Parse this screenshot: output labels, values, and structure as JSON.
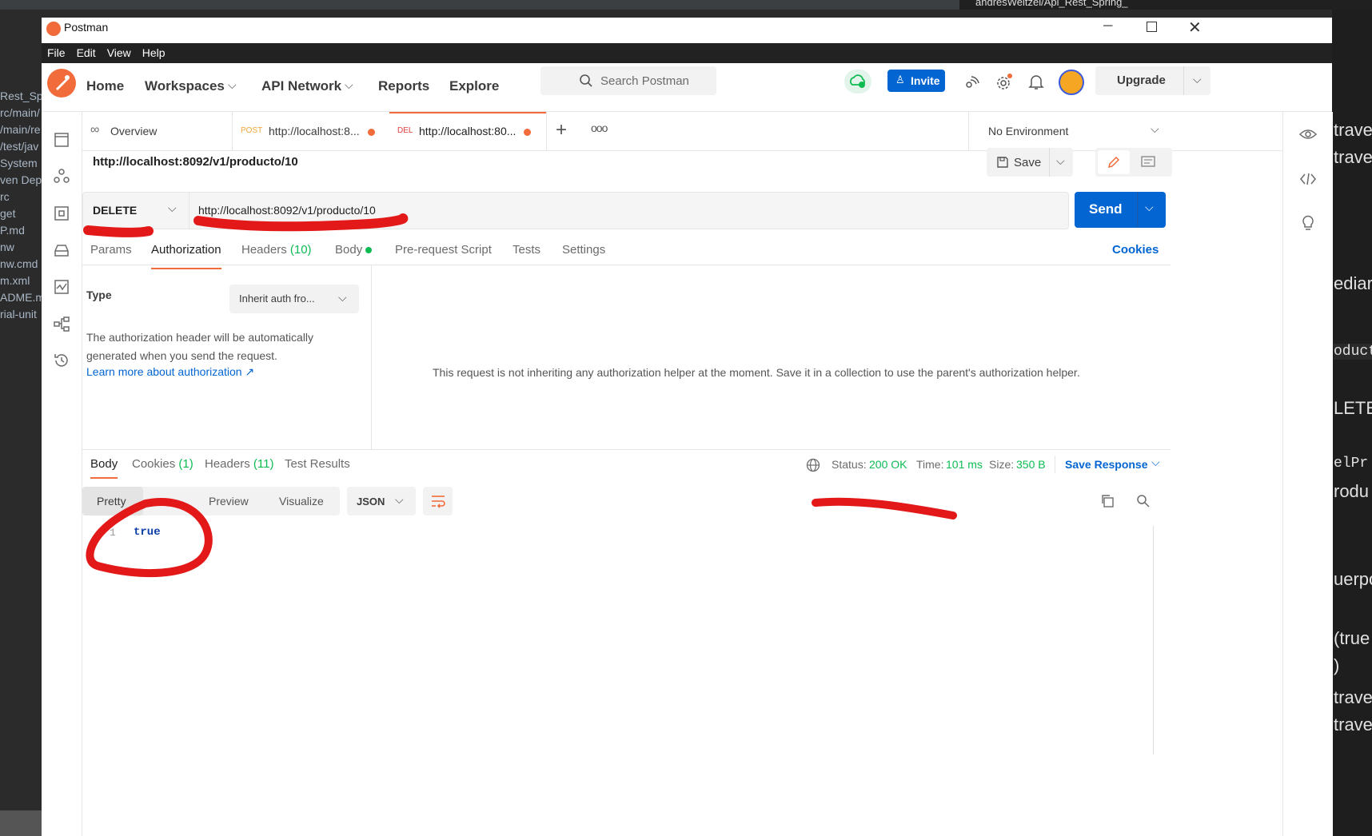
{
  "ide": {
    "left_files": [
      "Rest_Sp",
      "rc/main/",
      "/main/re",
      "/test/jav",
      "System",
      "ven Dep",
      "rc",
      "get",
      "P.md",
      "nw",
      "nw.cmd",
      "m.xml",
      "ADME.m",
      "rial-unit"
    ],
    "right_fragments": [
      "trave",
      "trave",
      "ediar",
      "oduct",
      "LETE",
      "elPr",
      "rodu",
      "uerpo",
      "(true",
      ")",
      "trave",
      "trave"
    ],
    "tab_title": "andresWeitzel/Api_Rest_Spring_"
  },
  "window": {
    "title": "Postman"
  },
  "menu": [
    "File",
    "Edit",
    "View",
    "Help"
  ],
  "header": {
    "nav": {
      "home": "Home",
      "workspaces": "Workspaces",
      "api_network": "API Network",
      "reports": "Reports",
      "explore": "Explore"
    },
    "search_placeholder": "Search Postman",
    "invite": "Invite",
    "upgrade": "Upgrade"
  },
  "tabs": {
    "overview": "Overview",
    "tab1": {
      "method": "POST",
      "url": "http://localhost:8..."
    },
    "tab2": {
      "method": "DEL",
      "url": "http://localhost:80..."
    },
    "environment": "No Environment"
  },
  "request": {
    "name": "http://localhost:8092/v1/producto/10",
    "save": "Save",
    "method": "DELETE",
    "url": "http://localhost:8092/v1/producto/10",
    "send": "Send",
    "subtabs": {
      "params": "Params",
      "authorization": "Authorization",
      "headers": "Headers",
      "headers_count": "(10)",
      "body": "Body",
      "prerequest": "Pre-request Script",
      "tests": "Tests",
      "settings": "Settings",
      "cookies": "Cookies"
    }
  },
  "auth": {
    "type_label": "Type",
    "type_value": "Inherit auth fro...",
    "desc_line1": "The authorization header will be automatically",
    "desc_line2": "generated when you send the request.",
    "learn_more": "Learn more about authorization ↗",
    "message": "This request is not inheriting any authorization helper at the moment. Save it in a collection to use the parent's authorization helper."
  },
  "response": {
    "tabs": {
      "body": "Body",
      "cookies": "Cookies",
      "cookies_count": "(1)",
      "headers": "Headers",
      "headers_count": "(11)",
      "test_results": "Test Results"
    },
    "status_label": "Status:",
    "status_value": "200 OK",
    "time_label": "Time:",
    "time_value": "101 ms",
    "size_label": "Size:",
    "size_value": "350 B",
    "save_response": "Save Response",
    "view_modes": {
      "pretty": "Pretty",
      "preview": "Preview",
      "visualize": "Visualize"
    },
    "format": "JSON",
    "line_number": "1",
    "body_value": "true"
  },
  "colors": {
    "accent": "#f26b3a",
    "blue": "#0265d2",
    "green": "#0cbb52",
    "annotation_red": "#e31919"
  }
}
